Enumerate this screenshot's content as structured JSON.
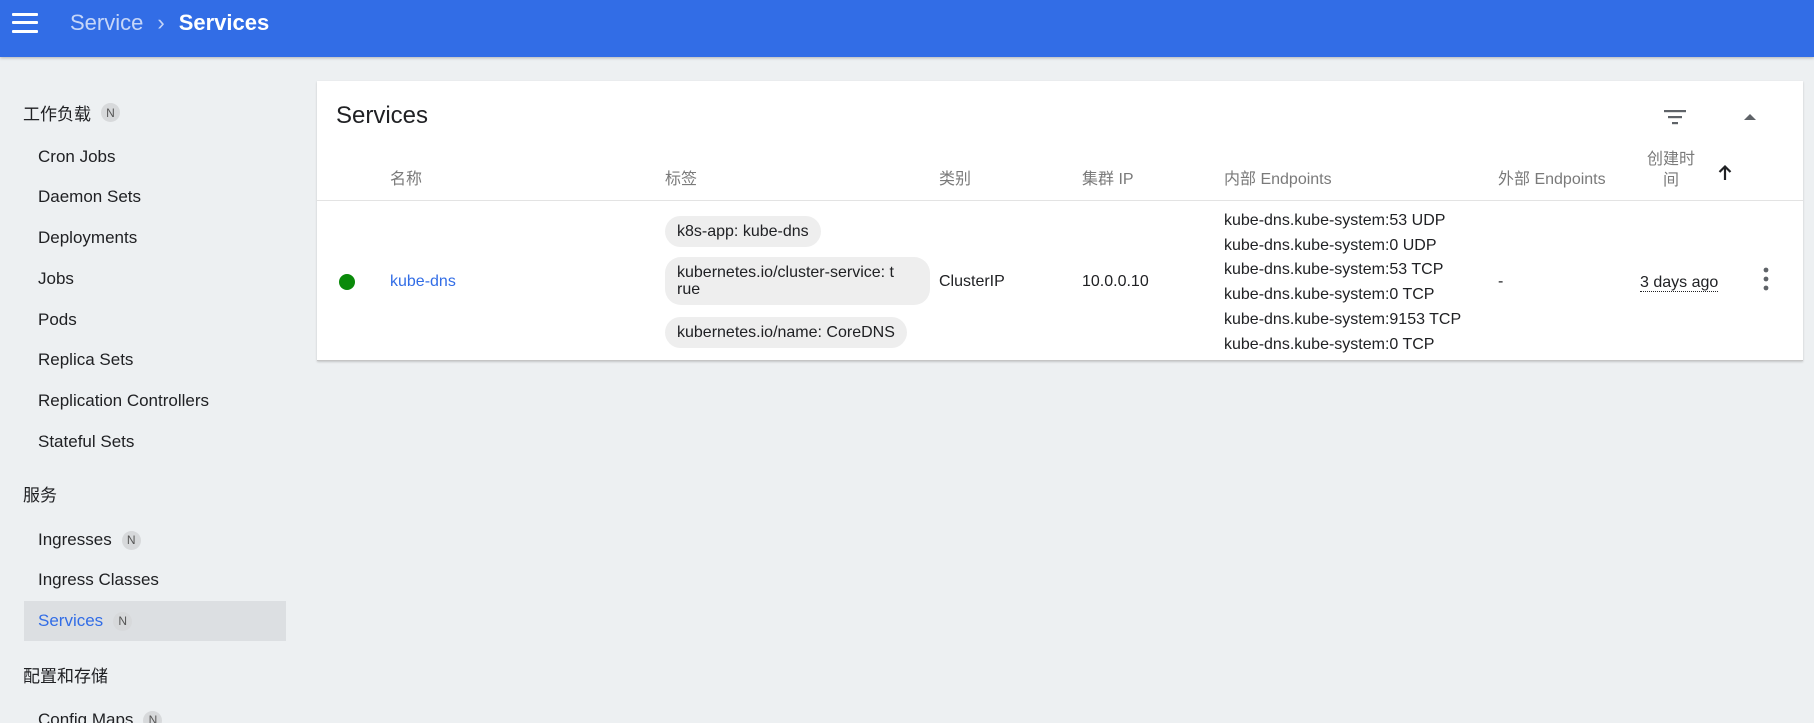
{
  "header": {
    "breadcrumb_parent": "Service",
    "breadcrumb_separator": "›",
    "breadcrumb_current": "Services",
    "bar_color": "#326de6"
  },
  "sidebar": {
    "groups": [
      {
        "label": "工作负载",
        "badge": "N"
      },
      {
        "label": "服务"
      },
      {
        "label": "配置和存储"
      }
    ],
    "workloads": [
      {
        "label": "Cron Jobs"
      },
      {
        "label": "Daemon Sets"
      },
      {
        "label": "Deployments"
      },
      {
        "label": "Jobs"
      },
      {
        "label": "Pods"
      },
      {
        "label": "Replica Sets"
      },
      {
        "label": "Replication Controllers"
      },
      {
        "label": "Stateful Sets"
      }
    ],
    "services": [
      {
        "label": "Ingresses",
        "badge": "N"
      },
      {
        "label": "Ingress Classes"
      },
      {
        "label": "Services",
        "badge": "N",
        "active": true
      }
    ],
    "config": [
      {
        "label": "Config Maps",
        "badge": "N"
      }
    ]
  },
  "card": {
    "title": "Services",
    "filter_icon": "filter-list-icon",
    "collapse_icon": "arrow-drop-up-icon"
  },
  "table": {
    "columns": {
      "name": "名称",
      "labels": "标签",
      "type": "类别",
      "cluster_ip": "集群 IP",
      "internal_endpoints": "内部 Endpoints",
      "external_endpoints": "外部 Endpoints",
      "created_line1": "创建时",
      "created_line2": "间",
      "sort_icon": "arrow-upward-icon"
    },
    "rows": [
      {
        "status": "running",
        "status_color": "#0a8a0a",
        "name": "kube-dns",
        "labels": [
          "k8s-app: kube-dns",
          "kubernetes.io/cluster-service: t",
          "rue",
          "kubernetes.io/name: CoreDNS"
        ],
        "type": "ClusterIP",
        "cluster_ip": "10.0.0.10",
        "internal_endpoints": [
          "kube-dns.kube-system:53 UDP",
          "kube-dns.kube-system:0 UDP",
          "kube-dns.kube-system:53 TCP",
          "kube-dns.kube-system:0 TCP",
          "kube-dns.kube-system:9153 TCP",
          "kube-dns.kube-system:0 TCP"
        ],
        "external_endpoints": "-",
        "age": "3 days ago",
        "actions_icon": "more-vert-icon"
      }
    ]
  }
}
